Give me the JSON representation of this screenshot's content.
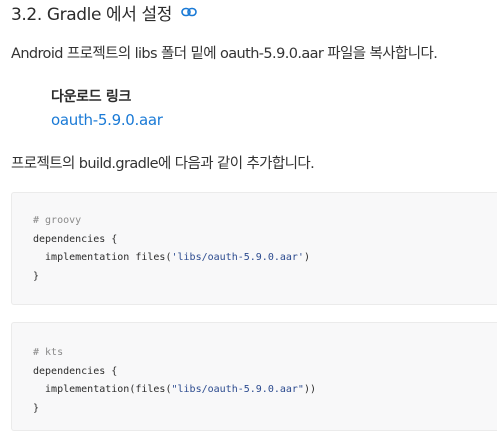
{
  "section": {
    "heading": "3.2. Gradle 에서 설정",
    "anchor_icon": "link-icon"
  },
  "intro_text": "Android 프로젝트의 libs 폴더 밑에 oauth-5.9.0.aar 파일을 복사합니다.",
  "download": {
    "title": "다운로드 링크",
    "link_text": "oauth-5.9.0.aar"
  },
  "instruction_text": "프로젝트의 build.gradle에 다음과 같이 추가합니다.",
  "code_blocks": [
    {
      "lines": [
        {
          "comment": "# groovy"
        },
        {
          "text": "dependencies {"
        },
        {
          "prefix": "  implementation files(",
          "string": "'libs/oauth-5.9.0.aar'",
          "suffix": ")"
        },
        {
          "text": "}"
        }
      ]
    },
    {
      "lines": [
        {
          "comment": "# kts"
        },
        {
          "text": "dependencies {"
        },
        {
          "prefix": "  implementation(files(",
          "string": "\"libs/oauth-5.9.0.aar\"",
          "suffix": "))"
        },
        {
          "text": "}"
        }
      ]
    }
  ],
  "colors": {
    "link": "#1a7ad6",
    "code_background": "#f8f8f9",
    "code_comment": "#8a8a8a",
    "code_string": "#2c4b8f"
  }
}
